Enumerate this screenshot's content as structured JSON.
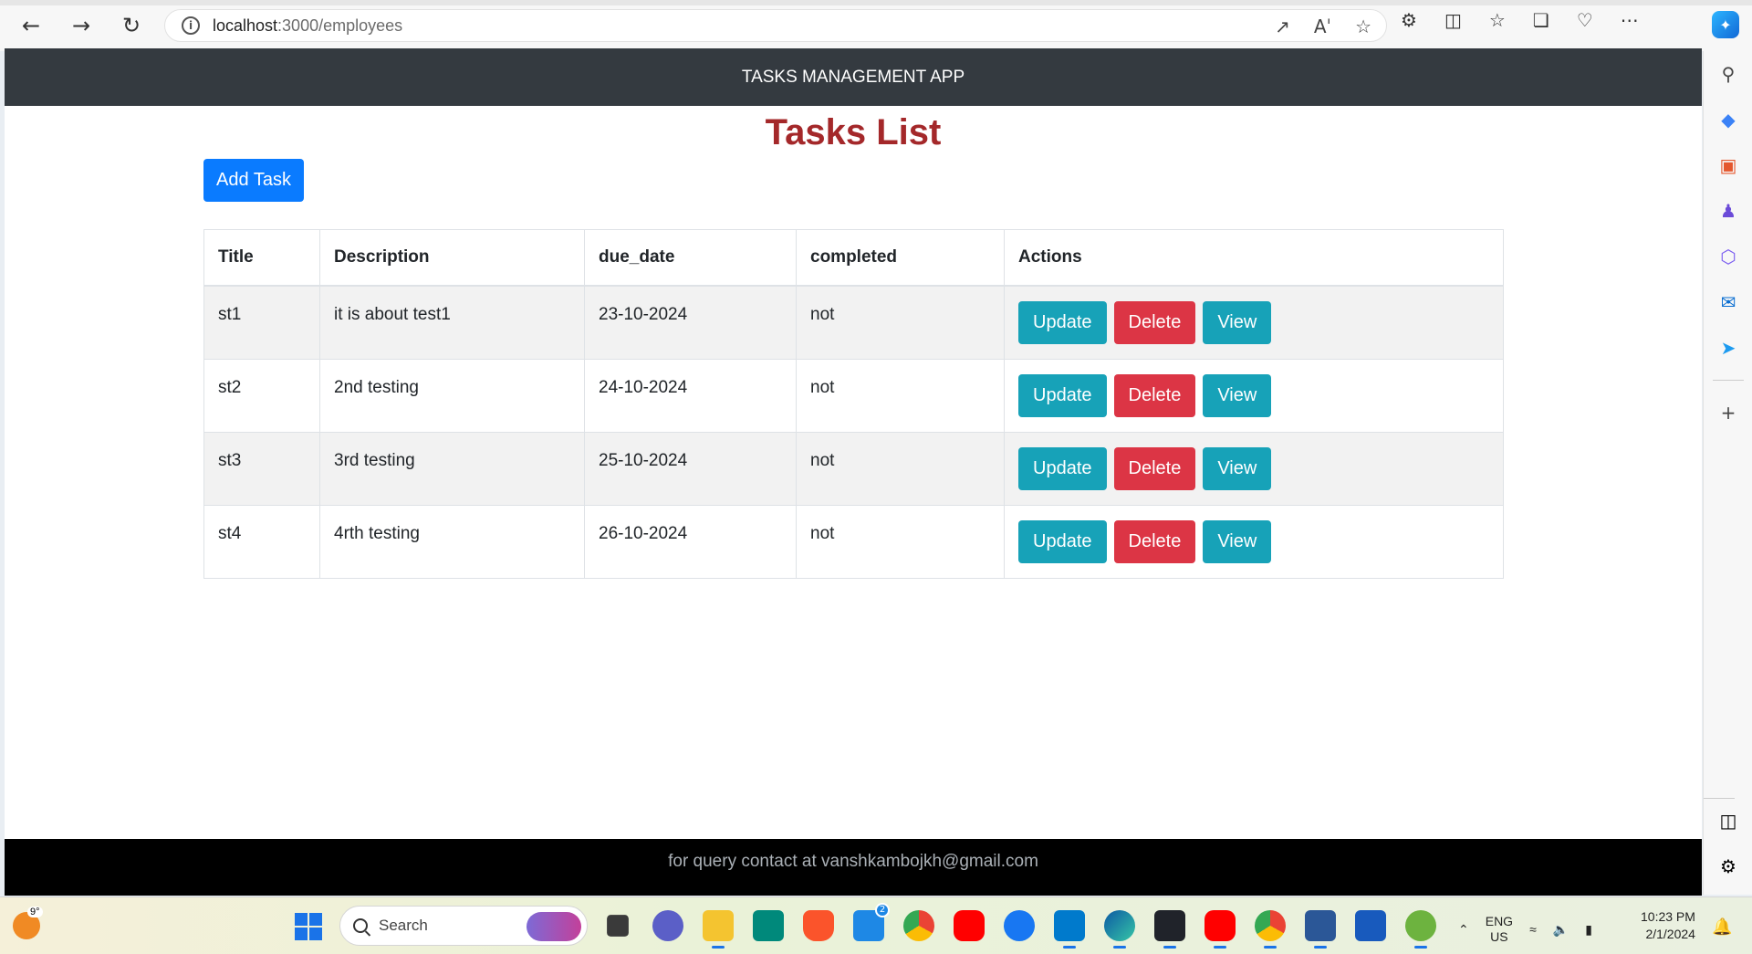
{
  "browser": {
    "url_host": "localhost",
    "url_path": ":3000/employees"
  },
  "app": {
    "header_title": "TASKS MANAGEMENT APP",
    "page_title": "Tasks List",
    "add_button": "Add Task",
    "footer_text": "for query contact at vanshkambojkh@gmail.com"
  },
  "table": {
    "headers": [
      "Title",
      "Description",
      "due_date",
      "completed",
      "Actions"
    ],
    "rows": [
      {
        "title": "st1",
        "description": "it is about test1",
        "due_date": "23-10-2024",
        "completed": "not"
      },
      {
        "title": "st2",
        "description": "2nd testing",
        "due_date": "24-10-2024",
        "completed": "not"
      },
      {
        "title": "st3",
        "description": "3rd testing",
        "due_date": "25-10-2024",
        "completed": "not"
      },
      {
        "title": "st4",
        "description": "4rth testing",
        "due_date": "26-10-2024",
        "completed": "not"
      }
    ],
    "actions": {
      "update": "Update",
      "delete": "Delete",
      "view": "View"
    }
  },
  "colors": {
    "header_bg": "#343a40",
    "title_color": "#a4282a",
    "primary": "#0a7bff",
    "info": "#17a2b8",
    "danger": "#dc3545",
    "footer_bg": "#000000"
  },
  "taskbar": {
    "weather_temp": "9°",
    "search_placeholder": "Search",
    "lang_line1": "ENG",
    "lang_line2": "US",
    "time": "10:23 PM",
    "date": "2/1/2024",
    "mail_badge": "2",
    "apps": [
      "file-explorer-icon",
      "meet-icon",
      "brave-icon",
      "mail-icon",
      "chrome-icon",
      "youtube-icon",
      "facebook-icon",
      "vscode-icon",
      "edge-icon",
      "react-icon",
      "youtube-icon",
      "chrome-icon",
      "remote-desktop-icon",
      "word-icon",
      "spring-icon"
    ]
  }
}
